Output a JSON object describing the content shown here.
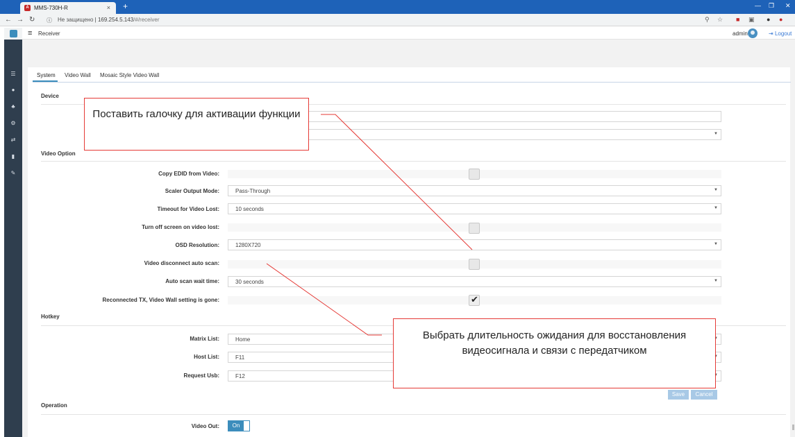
{
  "browser": {
    "tab_title": "MMS-730H-R",
    "tab_close": "×",
    "new_tab": "+",
    "not_secure": "Не защищено",
    "host": "169.254.5.143",
    "path": "/#/receiver"
  },
  "header": {
    "breadcrumb": "Receiver",
    "user": "admin",
    "logout": "Logout"
  },
  "tabs": [
    "System",
    "Video Wall",
    "Mosaic Style Video Wall"
  ],
  "sections": {
    "device": "Device",
    "video_option": "Video Option",
    "hotkey": "Hotkey",
    "operation": "Operation"
  },
  "device": {
    "caret": "▼"
  },
  "video_option": {
    "copy_edid_label": "Copy EDID from Video:",
    "copy_edid_checked": false,
    "scaler_label": "Scaler Output Mode:",
    "scaler_value": "Pass-Through",
    "timeout_label": "Timeout for Video Lost:",
    "timeout_value": "10 seconds",
    "turn_off_label": "Turn off screen on video lost:",
    "turn_off_checked": false,
    "osd_label": "OSD Resolution:",
    "osd_value": "1280X720",
    "disconnect_label": "Video disconnect auto scan:",
    "disconnect_checked": false,
    "wait_label": "Auto scan wait time:",
    "wait_value": "30 seconds",
    "reconnected_label": "Reconnected TX, Video Wall setting is gone:",
    "reconnected_checked": true
  },
  "hotkey": {
    "matrix_label": "Matrix List:",
    "matrix_value": "Home",
    "host_label": "Host List:",
    "host_value": "F11",
    "request_label": "Request Usb:",
    "request_value": "F12",
    "save": "Save",
    "cancel": "Cancel"
  },
  "operation": {
    "video_out_label": "Video Out:",
    "video_out_value": "On"
  },
  "callouts": {
    "top": "Поставить галочку для активации функции",
    "bottom": "Выбрать длительность ожидания для восстановления видеосигнала и связи с передатчиком"
  },
  "colors": {
    "accent": "#3c8dbc",
    "sidebar": "#2f3e4e",
    "callout_border": "#e53935"
  }
}
